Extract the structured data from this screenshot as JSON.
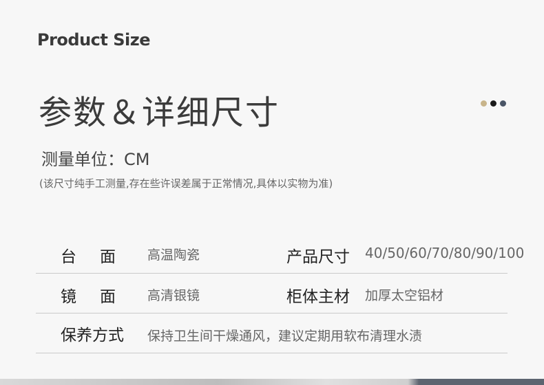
{
  "section_title_en": "Product Size",
  "title_cn": "参数＆详细尺寸",
  "unit_text": "测量单位：CM",
  "note_text": "(该尺寸纯手工测量,存在些许误差属于正常情况,具体以实物为准)",
  "dots_colors": [
    "#c8b48a",
    "#1a1a1a",
    "#4a5566"
  ],
  "specs": {
    "countertop": {
      "label": "台面",
      "value": "高温陶瓷"
    },
    "product_size": {
      "label": "产品尺寸",
      "value": "40/50/60/70/80/90/100"
    },
    "mirror": {
      "label": "镜面",
      "value": "高清银镜"
    },
    "cabinet_material": {
      "label": "柜体主材",
      "value": "加厚太空铝材"
    },
    "maintenance": {
      "label": "保养方式",
      "value": "保持卫生间干燥通风，建议定期用软布清理水渍"
    }
  }
}
